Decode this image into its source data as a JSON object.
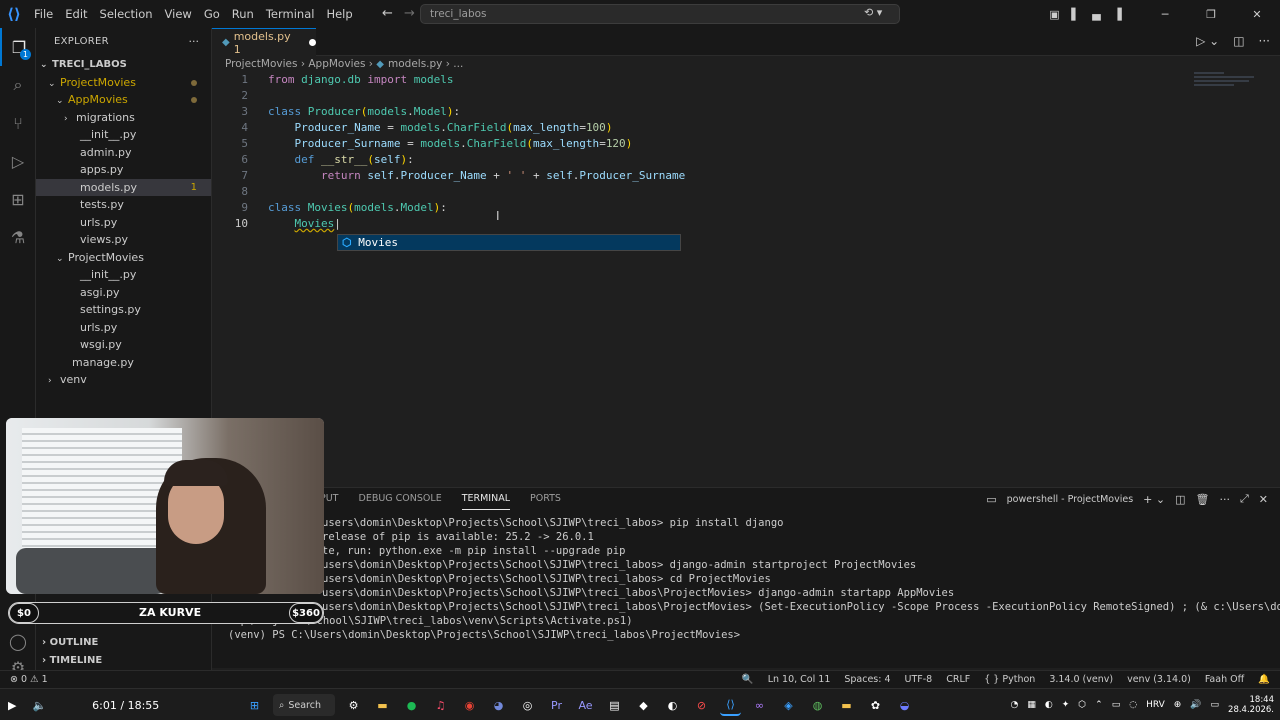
{
  "titlebar": {
    "menus": [
      "File",
      "Edit",
      "Selection",
      "View",
      "Go",
      "Run",
      "Terminal",
      "Help"
    ],
    "search": "treci_labos"
  },
  "sidebar": {
    "header": "EXPLORER",
    "root": "TRECI_LABOS",
    "items": [
      {
        "label": "ProjectMovies",
        "indent": 1,
        "kind": "folder-open",
        "warn": true
      },
      {
        "label": "AppMovies",
        "indent": 2,
        "kind": "folder-open",
        "warn": true
      },
      {
        "label": "migrations",
        "indent": 3,
        "kind": "folder"
      },
      {
        "label": "__init__.py",
        "indent": 3,
        "kind": "py"
      },
      {
        "label": "admin.py",
        "indent": 3,
        "kind": "py"
      },
      {
        "label": "apps.py",
        "indent": 3,
        "kind": "py"
      },
      {
        "label": "models.py",
        "indent": 3,
        "kind": "py",
        "selected": true,
        "badge": "1"
      },
      {
        "label": "tests.py",
        "indent": 3,
        "kind": "py"
      },
      {
        "label": "urls.py",
        "indent": 3,
        "kind": "py"
      },
      {
        "label": "views.py",
        "indent": 3,
        "kind": "py"
      },
      {
        "label": "ProjectMovies",
        "indent": 2,
        "kind": "folder-open"
      },
      {
        "label": "__init__.py",
        "indent": 3,
        "kind": "py"
      },
      {
        "label": "asgi.py",
        "indent": 3,
        "kind": "py"
      },
      {
        "label": "settings.py",
        "indent": 3,
        "kind": "py"
      },
      {
        "label": "urls.py",
        "indent": 3,
        "kind": "py"
      },
      {
        "label": "wsgi.py",
        "indent": 3,
        "kind": "py"
      },
      {
        "label": "manage.py",
        "indent": 2,
        "kind": "py"
      },
      {
        "label": "venv",
        "indent": 1,
        "kind": "folder"
      }
    ],
    "outline": "OUTLINE",
    "timeline": "TIMELINE"
  },
  "editor": {
    "tab_label": "models.py 1",
    "breadcrumb": [
      "ProjectMovies",
      "AppMovies",
      "models.py",
      "..."
    ],
    "suggestion": "Movies",
    "lines": [
      "1",
      "2",
      "3",
      "4",
      "5",
      "6",
      "7",
      "8",
      "9",
      "10"
    ]
  },
  "panel": {
    "tabs": [
      "PUT",
      "DEBUG CONSOLE",
      "TERMINAL",
      "PORTS"
    ],
    "shell": "powershell - ProjectMovies",
    "terminal": [
      "users\\domin\\Desktop\\Projects\\School\\SJIWP\\treci_labos> pip install django",
      "release of pip is available: 25.2 -> 26.0.1",
      "te, run: python.exe -m pip install --upgrade pip",
      "users\\domin\\Desktop\\Projects\\School\\SJIWP\\treci_labos> django-admin startproject ProjectMovies",
      "users\\domin\\Desktop\\Projects\\School\\SJIWP\\treci_labos> cd ProjectMovies",
      "users\\domin\\Desktop\\Projects\\School\\SJIWP\\treci_labos\\ProjectMovies> django-admin startapp AppMovies",
      "users\\domin\\Desktop\\Projects\\School\\SJIWP\\treci_labos\\ProjectMovies> (Set-ExecutionPolicy -Scope Process -ExecutionPolicy RemoteSigned) ; (& c:\\Users\\domin\\Desk",
      "top\\Projects\\School\\SJIWP\\treci_labos\\venv\\Scripts\\Activate.ps1)",
      "(venv) PS C:\\Users\\domin\\Desktop\\Projects\\School\\SJIWP\\treci_labos\\ProjectMovies> "
    ]
  },
  "overlay": {
    "donation_left": "$0",
    "donation_label": "ZA KURVE",
    "donation_right": "$360"
  },
  "statusbar": {
    "problems": "⊗ 0 ⚠ 1",
    "position": "Ln 10, Col 11",
    "spaces": "Spaces: 4",
    "encoding": "UTF-8",
    "eol": "CRLF",
    "language": "Python",
    "interpreter": "3.14.0 (venv)",
    "env": "venv (3.14.0)",
    "extra": "Faah Off"
  },
  "taskbar": {
    "media_time": "6:01 / 18:55",
    "search": "Search",
    "lang": "HRV",
    "time": "18:44",
    "date": "28.4.2026."
  }
}
